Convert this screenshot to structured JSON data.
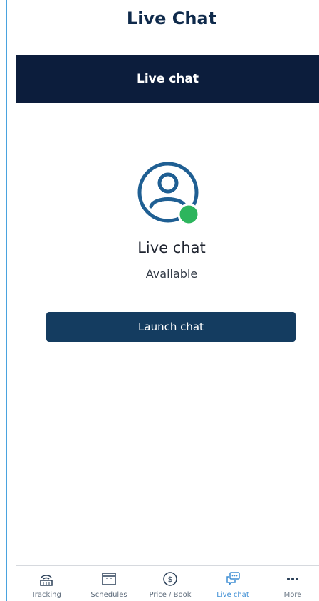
{
  "header": {
    "title": "Live Chat"
  },
  "section_bar": {
    "title": "Live chat"
  },
  "chat": {
    "name": "Live chat",
    "status": "Available",
    "status_color": "#2db55d",
    "launch_label": "Launch chat"
  },
  "tabbar": {
    "active_color": "#3e8ed4",
    "items": [
      {
        "label": "Tracking",
        "icon": "tracking-icon"
      },
      {
        "label": "Schedules",
        "icon": "calendar-icon"
      },
      {
        "label": "Price / Book",
        "icon": "dollar-icon"
      },
      {
        "label": "Live chat",
        "icon": "chat-bubble-icon",
        "active": true
      },
      {
        "label": "More",
        "icon": "more-icon"
      }
    ]
  }
}
